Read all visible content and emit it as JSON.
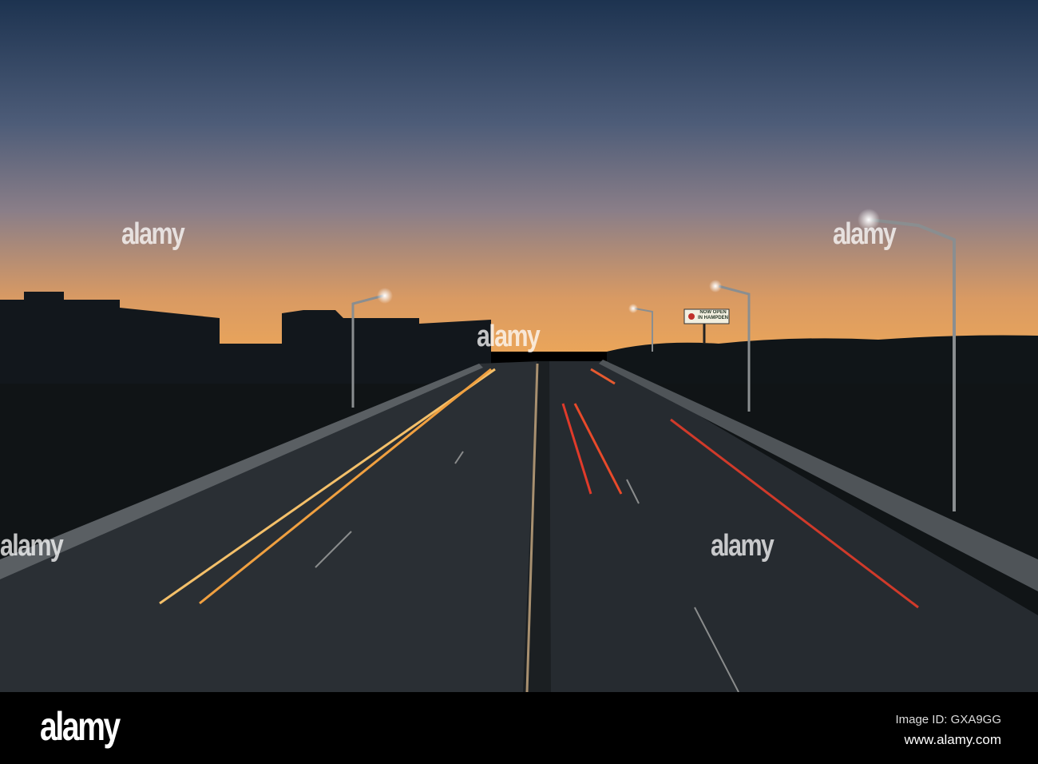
{
  "photo": {
    "subject": "Highway overpass at sunset with car light trails",
    "colors": {
      "sky_top": "#1f3550",
      "sky_mid": "#6c7088",
      "horizon": "#e7a05a",
      "ground": "#14191c",
      "road": "#2b3035"
    }
  },
  "watermark": {
    "text": "alamy"
  },
  "billboard": {
    "text": "NOW OPEN IN HAMPDEN"
  },
  "footer": {
    "logo": "alamy",
    "image_id": "Image ID: GXA9GG",
    "url": "www.alamy.com"
  }
}
